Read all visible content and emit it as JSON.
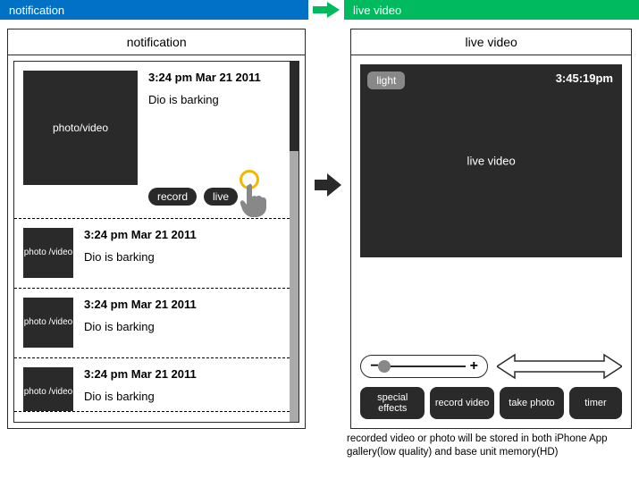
{
  "header": {
    "left_title": "notification",
    "right_title": "live video"
  },
  "notification_panel": {
    "title": "notification",
    "items": [
      {
        "thumb_label": "photo/video",
        "time": "3:24 pm Mar 21 2011",
        "msg": "Dio is barking",
        "record": "record",
        "live": "live"
      },
      {
        "thumb_label": "photo /video",
        "time": "3:24 pm Mar 21 2011",
        "msg": "Dio is barking"
      },
      {
        "thumb_label": "photo /video",
        "time": "3:24 pm Mar 21 2011",
        "msg": "Dio is barking"
      },
      {
        "thumb_label": "photo /video",
        "time": "3:24 pm Mar 21 2011",
        "msg": "Dio is barking"
      }
    ]
  },
  "live_panel": {
    "title": "live video",
    "light_label": "light",
    "clock": "3:45:19pm",
    "video_label": "live video",
    "zoom_minus": "−",
    "zoom_plus": "+",
    "buttons": {
      "special_effects": "special effects",
      "record_video": "record video",
      "take_photo": "take photo",
      "timer": "timer"
    }
  },
  "footnote": "recorded video or photo will be stored in both iPhone App gallery(low quality) and base unit memory(HD)"
}
